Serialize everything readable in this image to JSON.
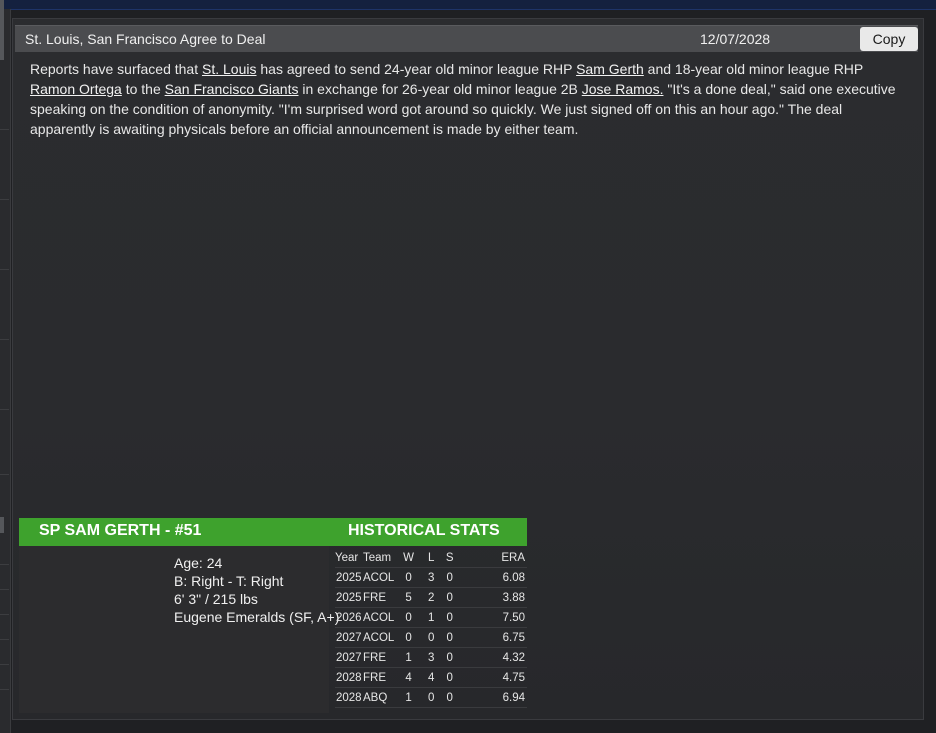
{
  "header": {
    "headline": "St. Louis, San Francisco Agree to Deal",
    "date": "12/07/2028",
    "copy_label": "Copy"
  },
  "article": {
    "t1": "Reports have surfaced that ",
    "l1": "St. Louis",
    "t2": " has agreed to send 24-year old minor league RHP ",
    "l2": "Sam Gerth",
    "t3": " and 18-year old minor league RHP ",
    "l3": "Ramon Ortega",
    "t4": " to the ",
    "l4": "San Francisco Giants",
    "t5": " in exchange for 26-year old minor league 2B ",
    "l5": "Jose Ramos.",
    "t6": " \"It's a done deal,\" said one executive speaking on the condition of anonymity. \"I'm surprised word got around so quickly. We just signed off on this an hour ago.\" The deal apparently is awaiting physicals before an official announcement is made by either team."
  },
  "player": {
    "title": "SP SAM GERTH - #51",
    "age": "Age: 24",
    "bats_throws": "B: Right - T: Right",
    "size": "6' 3\"  / 215 lbs",
    "team": "Eugene Emeralds (SF, A+)"
  },
  "stats": {
    "title": "HISTORICAL STATS",
    "headers": [
      "Year",
      "Team",
      "W",
      "L",
      "S",
      "ERA"
    ],
    "rows": [
      [
        "2025",
        "ACOL",
        "0",
        "3",
        "0",
        "6.08"
      ],
      [
        "2025",
        "FRE",
        "5",
        "2",
        "0",
        "3.88"
      ],
      [
        "2026",
        "ACOL",
        "0",
        "1",
        "0",
        "7.50"
      ],
      [
        "2027",
        "ACOL",
        "0",
        "0",
        "0",
        "6.75"
      ],
      [
        "2027",
        "FRE",
        "1",
        "3",
        "0",
        "4.32"
      ],
      [
        "2028",
        "FRE",
        "4",
        "4",
        "0",
        "4.75"
      ],
      [
        "2028",
        "ABQ",
        "1",
        "0",
        "0",
        "6.94"
      ]
    ]
  },
  "colors": {
    "accent_green": "#3ea22d",
    "header_gray": "#4b4c4f",
    "background": "#1f2023"
  }
}
